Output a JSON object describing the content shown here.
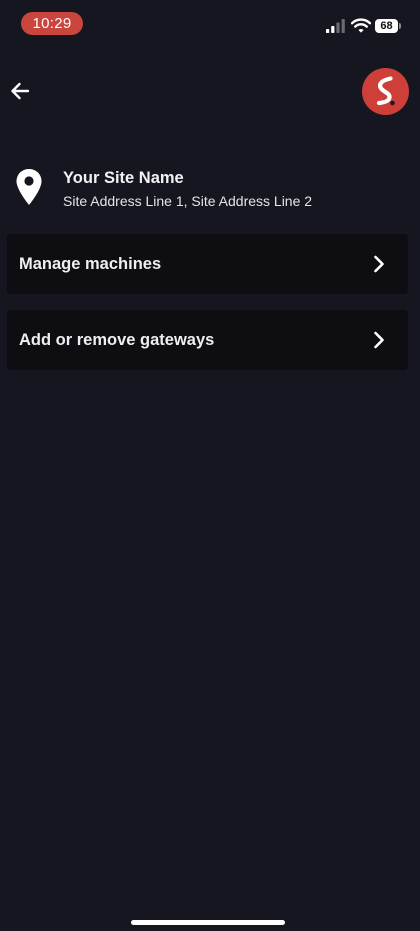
{
  "status_bar": {
    "time": "10:29",
    "battery": "68"
  },
  "colors": {
    "background": "#161620",
    "card": "#0d0d12",
    "accent": "#cf3f3a",
    "time_pill": "#c9453d"
  },
  "header": {
    "back_icon": "arrow-left-icon",
    "logo_icon": "brand-logo"
  },
  "site": {
    "name": "Your Site Name",
    "address": "Site Address Line 1, Site Address Line 2",
    "icon": "location-pin-icon"
  },
  "menu": {
    "items": [
      {
        "label": "Manage machines",
        "icon": "chevron-right-icon"
      },
      {
        "label": "Add or remove gateways",
        "icon": "chevron-right-icon"
      }
    ]
  }
}
